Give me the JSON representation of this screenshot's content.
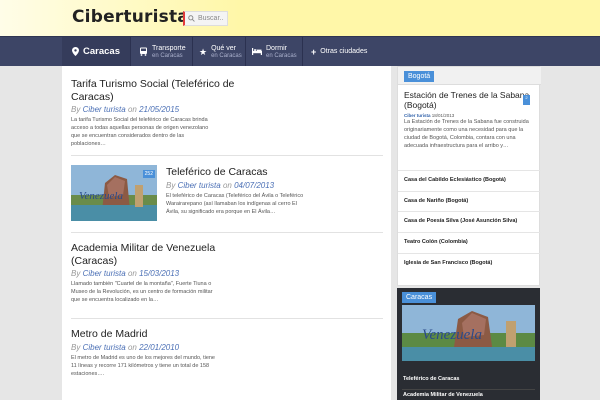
{
  "header": {
    "logo": "Ciberturista",
    "search_placeholder": "Buscar.."
  },
  "nav": {
    "location": "Caracas",
    "items": [
      {
        "label": "Transporte",
        "sub": "en Caracas",
        "icon": "bus-icon"
      },
      {
        "label": "Qué ver",
        "sub": "en Caracas",
        "icon": "star-icon"
      },
      {
        "label": "Dormir",
        "sub": "en Caracas",
        "icon": "bed-icon"
      },
      {
        "label": "Otras ciudades",
        "sub": "",
        "icon": "plus-icon"
      }
    ]
  },
  "articles": [
    {
      "title": "Tarifa Turismo Social (Teleférico de Caracas)",
      "by": "By",
      "author": "Ciber turista",
      "on": "on",
      "date": "21/05/2015",
      "excerpt": "La tarifa Turismo Social del teleférico de Caracas brinda acceso a todas aquellas personas de origen venezolano que se encuentran considerados dentro de las poblaciones…"
    },
    {
      "title": "Teleférico de Caracas",
      "by": "By",
      "author": "Ciber turista",
      "on": "on",
      "date": "04/07/2013",
      "excerpt": "El teleférico de Caracas (Teleférico del Ávila o Teleférico Warairarepano (así llamaban los indígenas al cerro El Ávila, su significado era porque en El Ávila…",
      "badge": "252"
    },
    {
      "title": "Academia Militar de Venezuela (Caracas)",
      "by": "By",
      "author": "Ciber turista",
      "on": "on",
      "date": "15/03/2013",
      "excerpt": "Llamado también \"Cuartel de la montaña\", Fuerte Tiuna o Museo de la Revolución, es un centro de formación militar que se encuentra localizado en la…"
    },
    {
      "title": "Metro de Madrid",
      "by": "By",
      "author": "Ciber turista",
      "on": "on",
      "date": "22/01/2010",
      "excerpt": "El metro de Madrid es uno de los mejores del mundo, tiene 11 líneas y recorre 171 kilómetros y tiene un total de 158 estaciones…."
    }
  ],
  "sidebar_bogota": {
    "tab": "Bogotá",
    "featured_title": "Estación de Trenes de la Sabana (Bogotá)",
    "featured_author": "Ciber turista",
    "featured_date": "18/01/2013",
    "featured_text": "La Estación de Trenes de la Sabana fue construida originariamente como una necesidad para que la ciudad de Bogotá, Colombia, contara con una adecuada infraestructura para el arribo y…",
    "badge": "2",
    "list": [
      "Casa del Cabildo Eclesiástico (Bogotá)",
      "Casa de Nariño (Bogotá)",
      "Casa de Poesía Silva (José Asunción Silva)",
      "Teatro Colón (Colombia)",
      "Iglesia de San Francisco (Bogotá)"
    ]
  },
  "sidebar_caracas": {
    "tab": "Caracas",
    "items": [
      "Teleférico de Caracas",
      "Academia Militar de Venezuela"
    ]
  }
}
